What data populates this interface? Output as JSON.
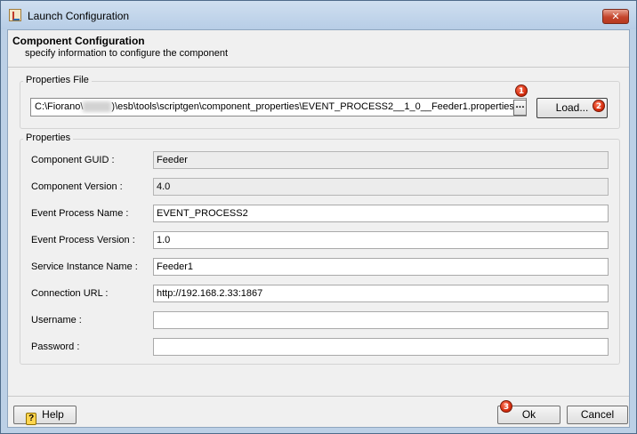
{
  "window": {
    "title": "Launch Configuration",
    "close_glyph": "✕",
    "icon": "java-app-icon"
  },
  "header": {
    "title": "Component Configuration",
    "subtitle": "specify information to configure the component"
  },
  "properties_file": {
    "legend": "Properties File",
    "path_prefix": "C:\\Fiorano\\",
    "path_suffix": ")\\esb\\tools\\scriptgen\\component_properties\\EVENT_PROCESS2__1_0__Feeder1.properties",
    "browse_label": "...",
    "load_label": "Load...",
    "markers": [
      "1",
      "2"
    ]
  },
  "properties": {
    "legend": "Properties",
    "rows": [
      {
        "label": "Component GUID :",
        "value": "Feeder",
        "readonly": true
      },
      {
        "label": "Component Version :",
        "value": "4.0",
        "readonly": true
      },
      {
        "label": "Event Process Name :",
        "value": "EVENT_PROCESS2",
        "readonly": false
      },
      {
        "label": "Event Process Version :",
        "value": "1.0",
        "readonly": false
      },
      {
        "label": "Service Instance Name :",
        "value": "Feeder1",
        "readonly": false
      },
      {
        "label": "Connection URL :",
        "value": "http://192.168.2.33:1867",
        "readonly": false
      },
      {
        "label": "Username :",
        "value": "",
        "readonly": false
      },
      {
        "label": "Password :",
        "value": "",
        "readonly": false
      }
    ]
  },
  "footer": {
    "help_label": "Help",
    "help_glyph": "?",
    "ok_label": "Ok",
    "cancel_label": "Cancel",
    "ok_marker": "3"
  }
}
